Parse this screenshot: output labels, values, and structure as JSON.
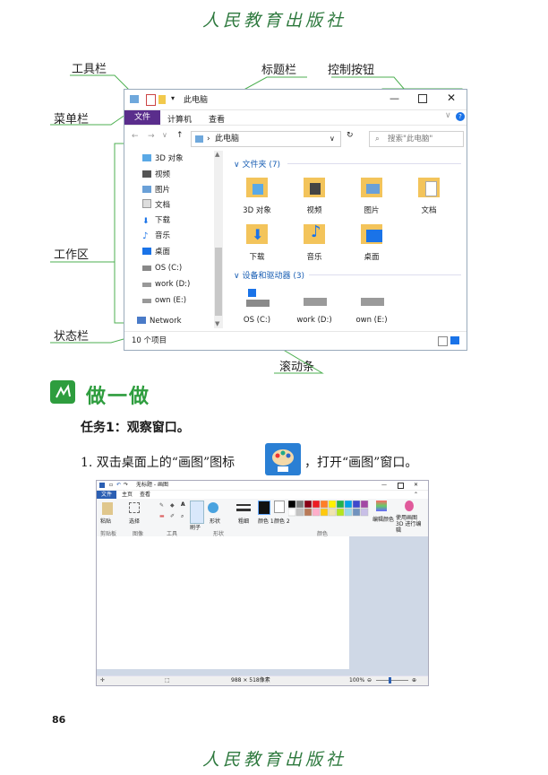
{
  "publisher": {
    "top": "人民教育出版社",
    "bottom": "人民教育出版社"
  },
  "callouts": {
    "toolbar": "工具栏",
    "titlebar": "标题栏",
    "controls": "控制按钮",
    "menubar": "菜单栏",
    "workarea": "工作区",
    "statusbar": "状态栏",
    "scrollbar": "滚动条"
  },
  "explorer": {
    "title": "此电脑",
    "menu": {
      "file": "文件",
      "computer": "计算机",
      "view": "查看"
    },
    "address": "此电脑",
    "search_placeholder": "搜索\"此电脑\"",
    "nav_items": [
      "3D 对象",
      "视频",
      "图片",
      "文档",
      "下载",
      "音乐",
      "桌面",
      "OS (C:)",
      "work (D:)",
      "own (E:)",
      "Network"
    ],
    "folders_group": "文件夹 (7)",
    "folders": [
      "3D 对象",
      "视频",
      "图片",
      "文档",
      "下载",
      "音乐",
      "桌面"
    ],
    "devices_group": "设备和驱动器 (3)",
    "drives": [
      "OS (C:)",
      "work (D:)",
      "own (E:)"
    ],
    "status": "10 个项目"
  },
  "section": {
    "heading": "做一做",
    "task": "任务1：观察窗口。"
  },
  "step1": {
    "before": "1. 双击桌面上的“画图”图标",
    "after": "，打开“画图”窗口。"
  },
  "paint": {
    "title": "无标题 - 画图",
    "tabs": {
      "file": "文件",
      "home": "主页",
      "view": "查看"
    },
    "groups": [
      "剪贴板",
      "图像",
      "工具",
      "形状",
      "颜色"
    ],
    "labels": {
      "paste": "粘贴",
      "select": "选择",
      "brush": "刷子",
      "shape": "形状",
      "size": "粗细",
      "color1": "颜色 1",
      "color2": "颜色 2",
      "edit_colors": "编辑颜色",
      "paint3d": "使用画图 3D 进行编辑"
    },
    "status_size": "988 × 518像素",
    "zoom": "100%"
  },
  "page_number": "86",
  "colors": {
    "accent_green": "#2e9d3e",
    "callout_line": "#4caf50",
    "menu_purple": "#5a2d8c",
    "paint_blue": "#2b5fb3"
  }
}
